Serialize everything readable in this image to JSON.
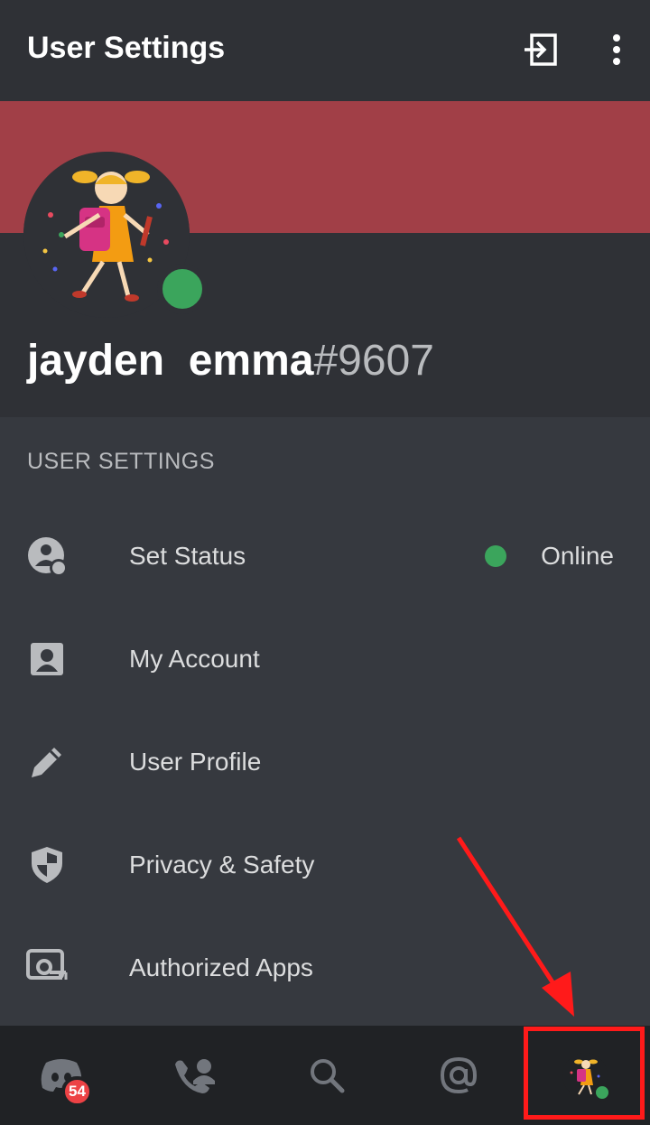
{
  "header": {
    "title": "User Settings",
    "logout_icon": "logout-icon",
    "more_icon": "more-vertical-icon"
  },
  "profile": {
    "name": "jayden  emma",
    "discriminator": "#9607",
    "banner_color": "#a13f47",
    "status_color": "#3ba55c"
  },
  "section": {
    "label": "USER SETTINGS"
  },
  "menu": [
    {
      "label": "Set Status",
      "icon": "status-icon",
      "value": "Online"
    },
    {
      "label": "My Account",
      "icon": "account-icon"
    },
    {
      "label": "User Profile",
      "icon": "pencil-icon"
    },
    {
      "label": "Privacy & Safety",
      "icon": "shield-icon"
    },
    {
      "label": "Authorized Apps",
      "icon": "authorized-apps-icon"
    }
  ],
  "bottom_nav": {
    "home_badge": "54",
    "items": [
      "discord-home-icon",
      "friends-icon",
      "search-icon",
      "mentions-icon",
      "profile-avatar"
    ]
  },
  "annotation": {
    "color": "#ff1a1a"
  }
}
